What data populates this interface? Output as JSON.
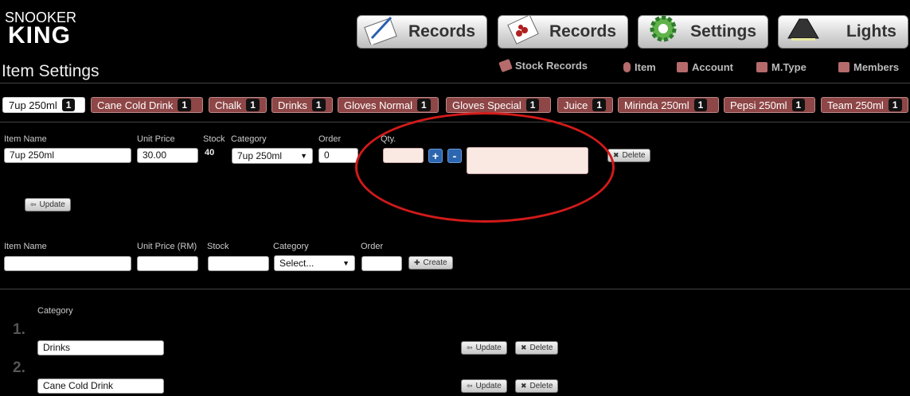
{
  "logo": {
    "top": "SNOOKER",
    "bottom": "KING"
  },
  "nav": [
    {
      "label": "Records",
      "icon": "notepad-icon"
    },
    {
      "label": "Records",
      "icon": "card-records-icon"
    },
    {
      "label": "Settings",
      "icon": "gear-icon"
    },
    {
      "label": "Lights",
      "icon": "lamp-icon"
    }
  ],
  "subnav": [
    {
      "label": "Stock Records",
      "icon": "stock-records-icon"
    },
    {
      "label": "Item",
      "icon": "item-icon"
    },
    {
      "label": "Account",
      "icon": "account-icon"
    },
    {
      "label": "M.Type",
      "icon": "mtype-icon"
    },
    {
      "label": "Members",
      "icon": "members-icon"
    }
  ],
  "page_title": "Item Settings",
  "tabs": [
    {
      "label": "7up 250ml",
      "count": "1"
    },
    {
      "label": "Cane Cold Drink",
      "count": "1"
    },
    {
      "label": "Chalk",
      "count": "1"
    },
    {
      "label": "Drinks",
      "count": "1"
    },
    {
      "label": "Gloves Normal",
      "count": "1"
    },
    {
      "label": "Gloves Special",
      "count": "1"
    },
    {
      "label": "Juice",
      "count": "1"
    },
    {
      "label": "Mirinda 250ml",
      "count": "1"
    },
    {
      "label": "Pepsi 250ml",
      "count": "1"
    },
    {
      "label": "Team 250ml",
      "count": "1"
    }
  ],
  "edit": {
    "item_name_label": "Item Name",
    "item_name": "7up 250ml",
    "unit_price_label": "Unit Price",
    "unit_price": "30.00",
    "stock_label": "Stock",
    "stock": "40",
    "category_label": "Category",
    "category": "7up 250ml",
    "order_label": "Order",
    "order": "0",
    "qty_label": "Qty.",
    "plus": "+",
    "minus": "-",
    "delete": "Delete",
    "update": "Update"
  },
  "create": {
    "item_name_label": "Item Name",
    "unit_price_label": "Unit Price (RM)",
    "stock_label": "Stock",
    "category_label": "Category",
    "category": "Select...",
    "order_label": "Order",
    "create": "Create"
  },
  "categories": {
    "header": "Category",
    "rows": [
      {
        "num": "1.",
        "name": "Drinks",
        "update": "Update",
        "delete": "Delete"
      },
      {
        "num": "2.",
        "name": "Cane Cold Drink",
        "update": "Update",
        "delete": "Delete"
      }
    ]
  },
  "colors": {
    "annotation": "#d21a1a",
    "tab": "#8e4646",
    "accent_button": "#2d66b0"
  }
}
